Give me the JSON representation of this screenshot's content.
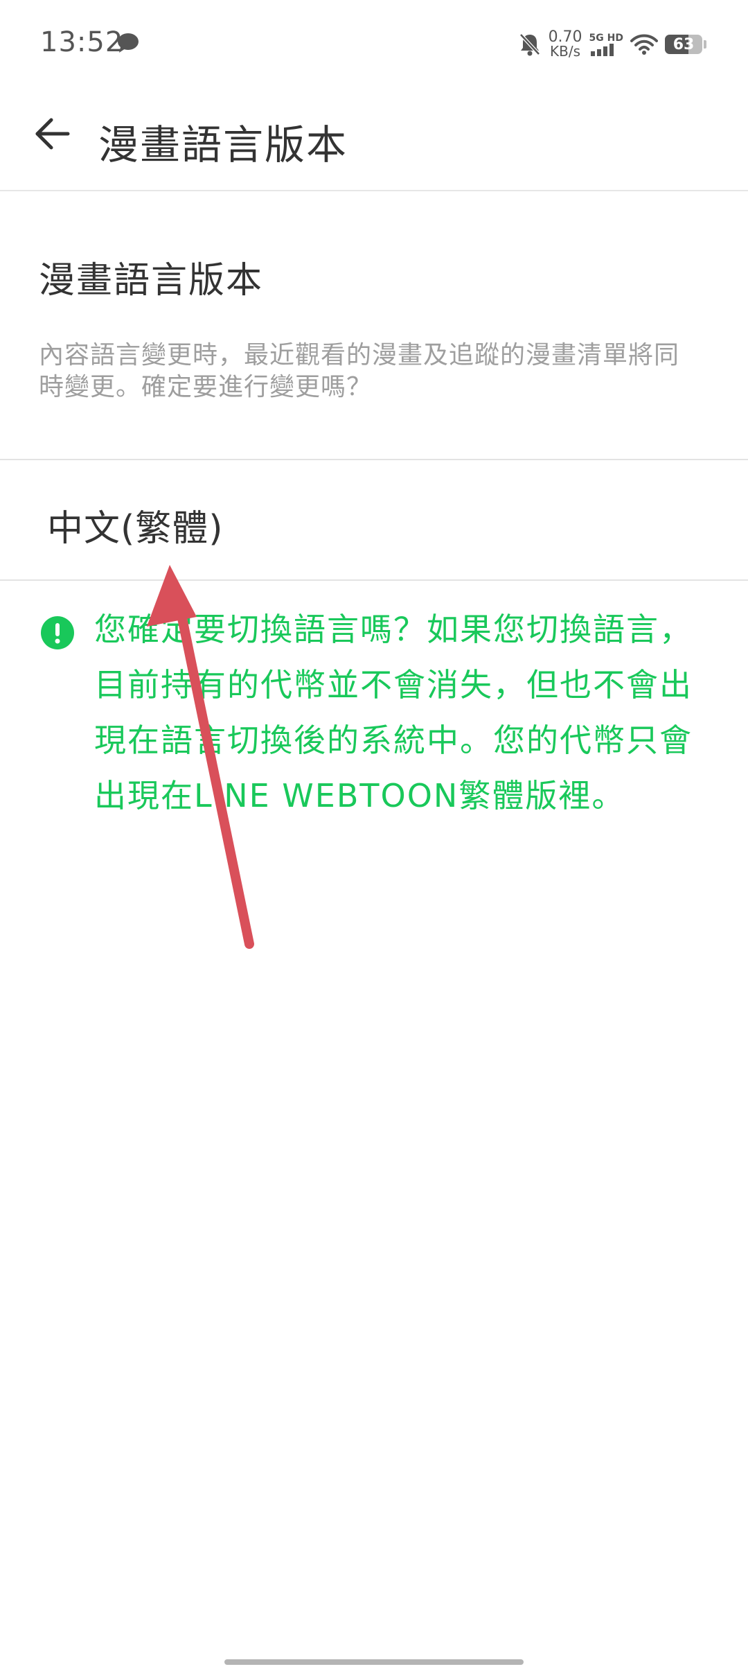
{
  "status_bar": {
    "time": "13:52",
    "net_speed_value": "0.70",
    "net_speed_unit": "KB/s",
    "net_type_top": "5G HD",
    "battery_level": "63",
    "icons": [
      "chat-bubble-icon",
      "bell-muted-icon",
      "signal-icon",
      "wifi-icon",
      "battery-icon"
    ]
  },
  "app_bar": {
    "title": "漫畫語言版本",
    "back_icon": "arrow-left-icon"
  },
  "section": {
    "title": "漫畫語言版本",
    "description": "內容語言變更時，最近觀看的漫畫及追蹤的漫畫清單將同時變更。確定要進行變更嗎？"
  },
  "language_option": {
    "label": "中文(繁體)"
  },
  "notice": {
    "icon": "exclamation-circle-icon",
    "text": "您確定要切換語言嗎？如果您切換語言，目前持有的代幣並不會消失，但也不會出現在語言切換後的系統中。您的代幣只會出現在LINE WEBTOON繁體版裡。"
  },
  "colors": {
    "accent_green": "#19c85a",
    "annotation_red": "#d9505a",
    "text_primary": "#333333",
    "text_secondary": "#9e9e9e"
  }
}
